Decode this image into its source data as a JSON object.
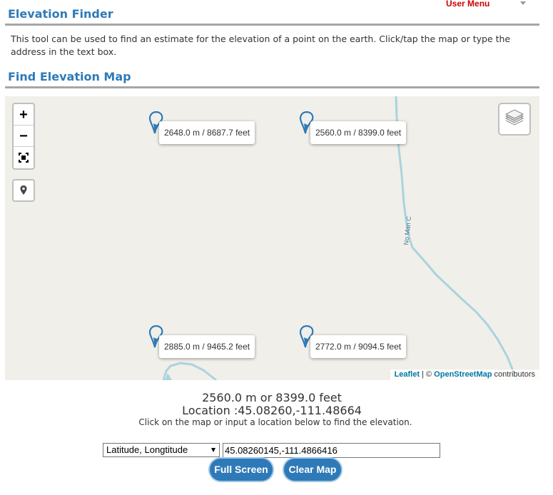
{
  "header": {
    "user_menu_label": "User Menu",
    "page_title": "Elevation Finder",
    "intro": "This tool can be used to find an estimate for the elevation of a point on the earth. Click/tap the map or type the address in the text box.",
    "map_section_title": "Find Elevation Map"
  },
  "map": {
    "zoom_in": "+",
    "zoom_out": "−",
    "street_label": "No Man C",
    "markers": [
      {
        "label": "2648.0 m / 8687.7 feet"
      },
      {
        "label": "2560.0 m / 8399.0 feet"
      },
      {
        "label": "2885.0 m / 9465.2 feet"
      },
      {
        "label": "2772.0 m / 9094.5 feet"
      }
    ],
    "attribution": {
      "leaflet": "Leaflet",
      "separator": " | © ",
      "osm": "OpenStreetMap",
      "suffix": " contributors"
    },
    "colors": {
      "land": "#f1efe9",
      "water": "#aad3df",
      "marker": "#2e7ab8"
    }
  },
  "result": {
    "elevation_text": "2560.0 m or 8399.0 feet",
    "location_text": "Location :45.08260,-111.48664",
    "hint": "Click on the map or input a location below to find the elevation."
  },
  "controls": {
    "input_type_selected": "Latitude, Longtitude",
    "location_value": "45.08260145,-111.4866416",
    "full_screen_label": "Full Screen",
    "clear_map_label": "Clear Map"
  }
}
